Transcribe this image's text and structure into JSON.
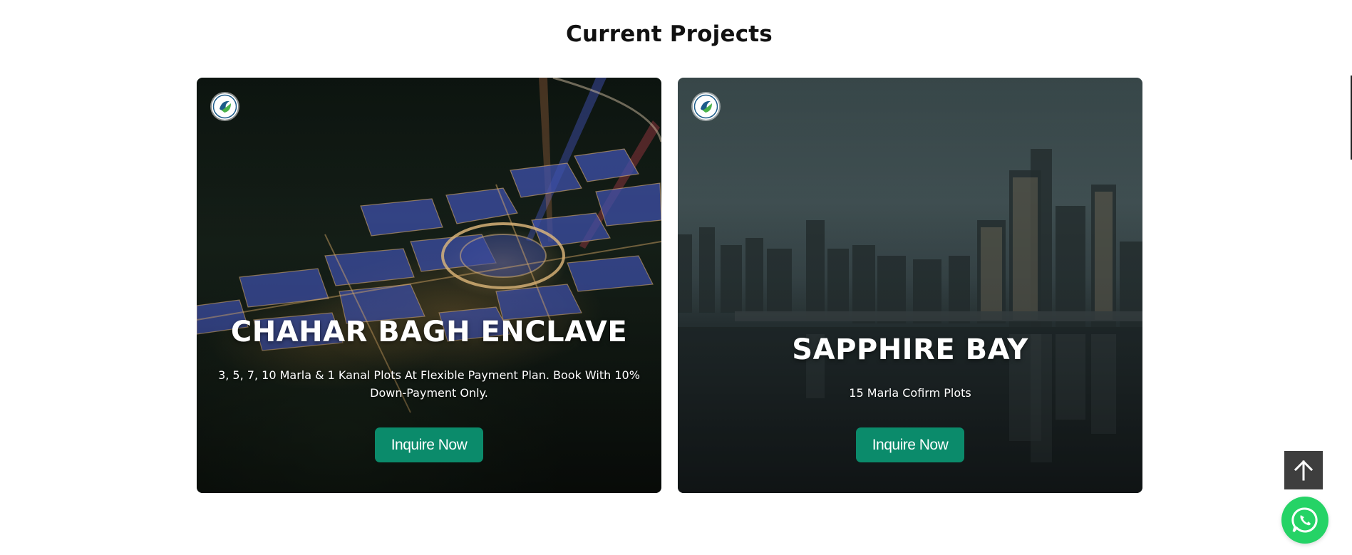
{
  "section": {
    "title": "Current Projects"
  },
  "projects": [
    {
      "title": "CHAHAR BAGH ENCLAVE",
      "description": "3, 5, 7, 10 Marla & 1 Kanal Plots At Flexible Payment Plan. Book With 10% Down-Payment Only.",
      "button_label": "Inquire Now"
    },
    {
      "title": "SAPPHIRE BAY",
      "description": "15 Marla Cofirm Plots",
      "button_label": "Inquire Now"
    }
  ],
  "floating": {
    "scroll_top_icon": "arrow-up-icon",
    "whatsapp_icon": "whatsapp-icon"
  },
  "colors": {
    "button_bg": "#0b8b6b",
    "whatsapp": "#25d366",
    "scroll_top_bg": "#3e3e3e"
  }
}
